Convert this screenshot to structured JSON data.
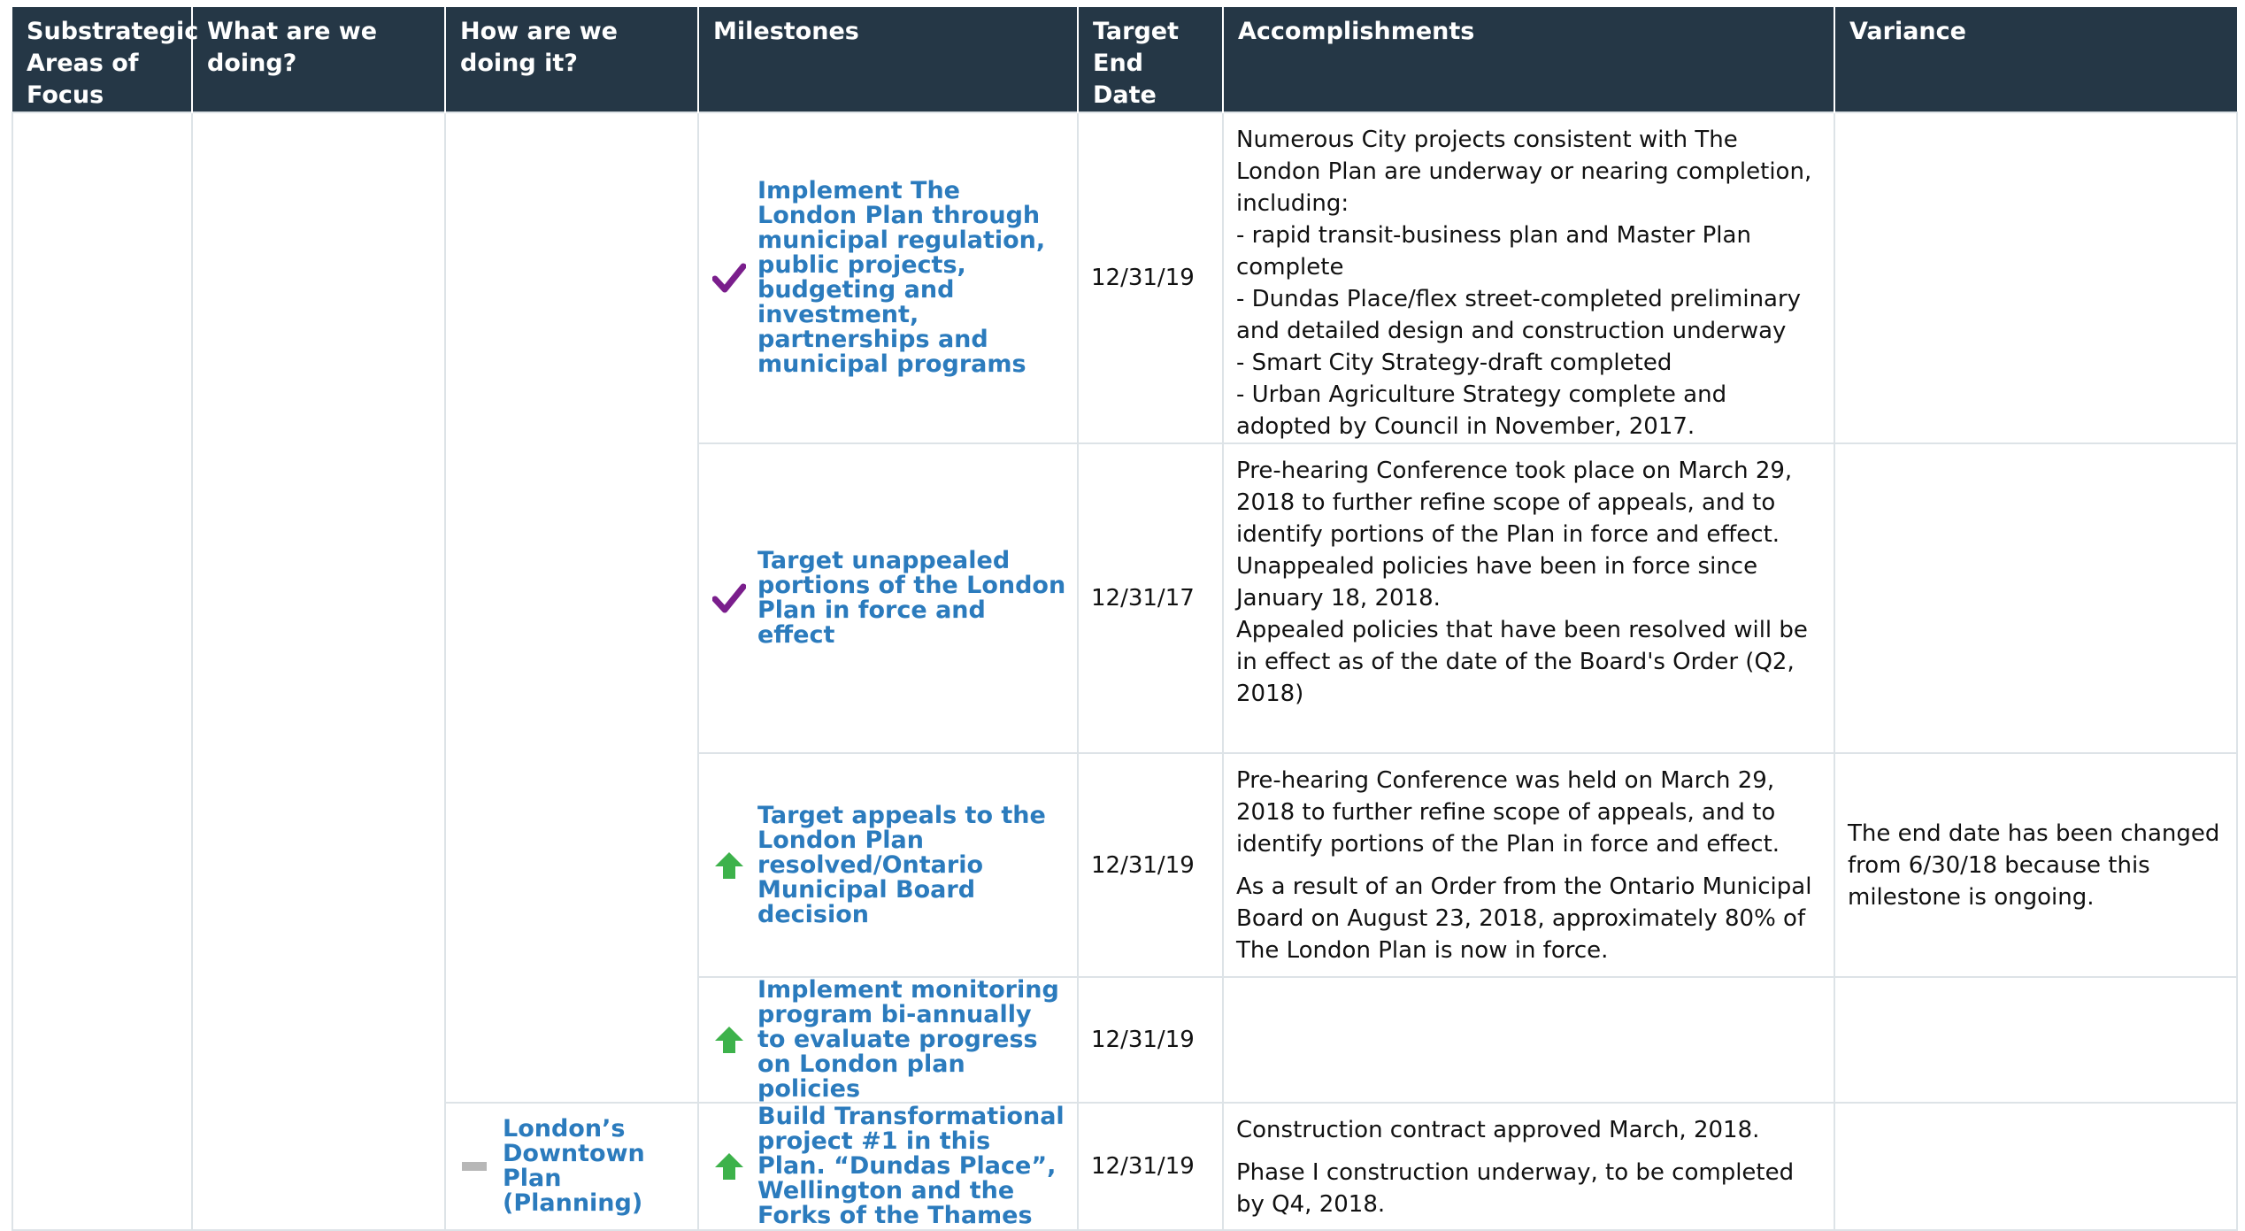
{
  "headers": [
    "Substrategic Areas of Focus",
    "What are we doing?",
    "How are we doing it?",
    "Milestones",
    "Target End Date",
    "Accomplishments",
    "Variance"
  ],
  "rows": [
    {
      "milestone": "Implement The London Plan through municipal regulation, public projects, budgeting and investment, partnerships and municipal programs",
      "status_icon": "checkmark-icon",
      "target_end_date": "12/31/19",
      "accomplishments": [
        "Numerous City projects consistent with The London Plan are underway or nearing completion, including:",
        "- rapid transit-business plan and Master Plan complete",
        "- Dundas Place/flex street-completed preliminary and detailed design and construction underway",
        "- Smart City Strategy-draft completed",
        "- Urban Agriculture Strategy complete and adopted by Council in November, 2017."
      ],
      "variance": ""
    },
    {
      "milestone": "Target unappealed portions of the London Plan in force and effect",
      "status_icon": "checkmark-icon",
      "target_end_date": "12/31/17",
      "accomplishments": [
        "Pre-hearing Conference took place on March 29, 2018 to further refine scope of appeals, and to identify portions of the Plan in force and effect.",
        "Unappealed policies have been in force since January 18, 2018.",
        "Appealed policies that have been resolved will be in effect as of the date of the Board's Order (Q2, 2018)"
      ],
      "variance": ""
    },
    {
      "milestone": "Target appeals to the London Plan resolved/Ontario Municipal Board decision",
      "status_icon": "up-arrow-icon",
      "target_end_date": "12/31/19",
      "accomplishments": [
        "Pre-hearing Conference was held on March 29, 2018 to further refine scope of appeals, and to identify portions of the Plan in force and effect.",
        "As a result of an Order from the Ontario Municipal Board on August 23, 2018, approximately 80% of The London Plan is now in force."
      ],
      "variance": "The end date has been changed from 6/30/18 because this milestone is ongoing."
    },
    {
      "milestone": "Implement monitoring program bi-annually to evaluate progress on London plan policies",
      "status_icon": "up-arrow-icon",
      "target_end_date": "12/31/19",
      "accomplishments": [],
      "variance": ""
    },
    {
      "how": "London’s Downtown Plan (Planning)",
      "how_icon": "dash-icon",
      "milestone": "Build Transformational project #1 in this Plan. “Dundas Place”, Wellington and the Forks of the Thames",
      "status_icon": "up-arrow-icon",
      "target_end_date": "12/31/19",
      "accomplishments": [
        "Construction contract approved March, 2018.",
        "Phase I construction underway, to be completed by Q4, 2018."
      ],
      "variance": ""
    }
  ],
  "colors": {
    "header_bg": "#253746",
    "header_text": "#ffffff",
    "link_blue": "#2b7bbd",
    "check_purple": "#7a1e8c",
    "arrow_green": "#3db24b",
    "grid": "#dde3e7"
  }
}
